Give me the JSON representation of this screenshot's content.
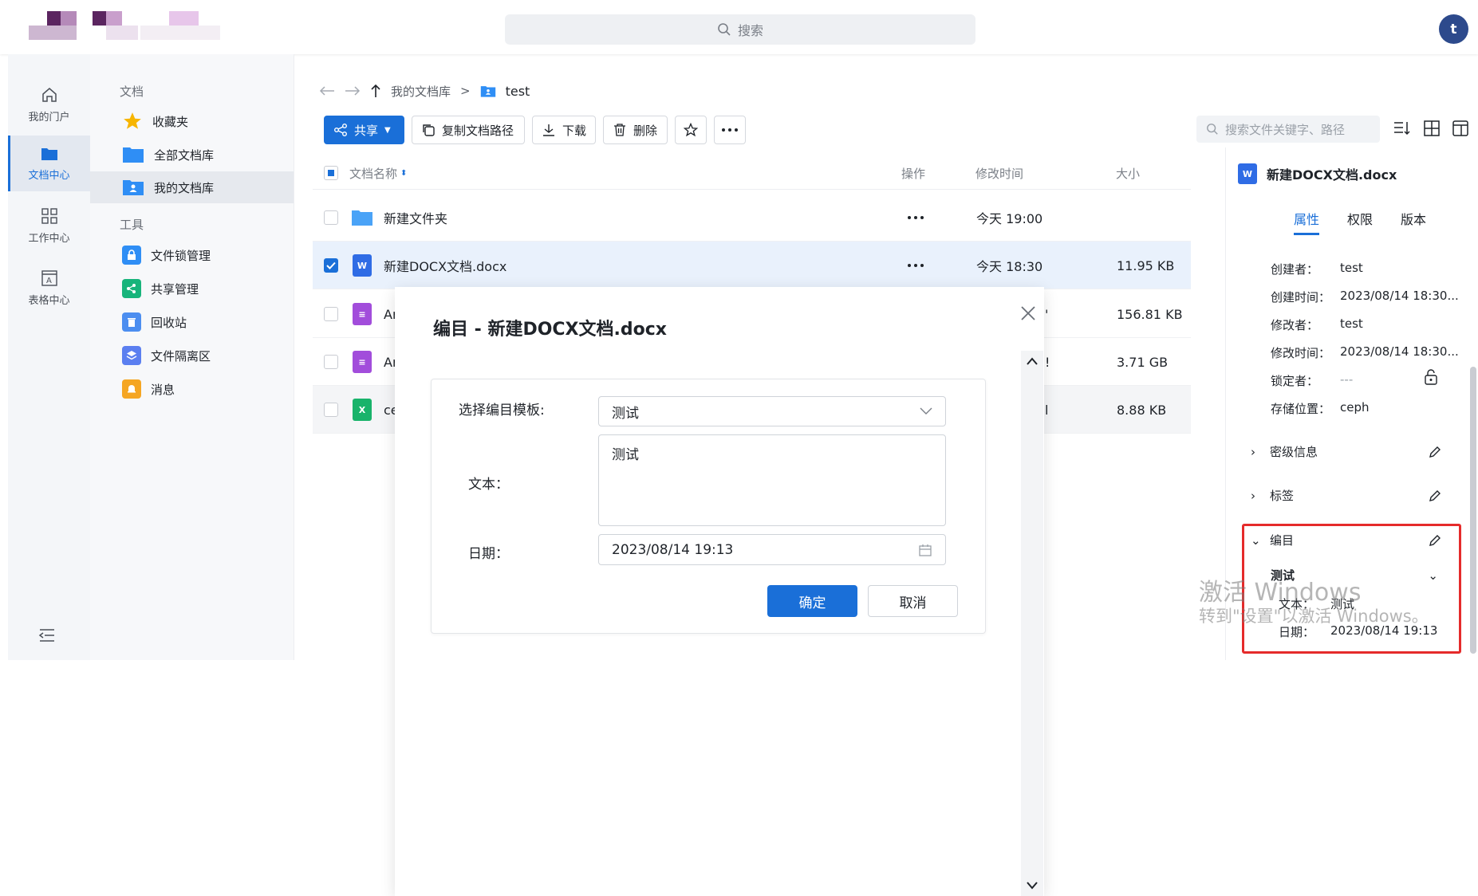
{
  "header": {
    "search_placeholder": "搜索",
    "avatar_letter": "t"
  },
  "rail": {
    "items": [
      {
        "label": "我的门户",
        "icon": "home-icon"
      },
      {
        "label": "文档中心",
        "icon": "folder-icon",
        "active": true
      },
      {
        "label": "工作中心",
        "icon": "grid-icon"
      },
      {
        "label": "表格中心",
        "icon": "table-icon"
      }
    ]
  },
  "sidenav": {
    "group_docs": "文档",
    "favorites": "收藏夹",
    "all_libraries": "全部文档库",
    "my_library": "我的文档库",
    "group_tools": "工具",
    "file_lock": "文件锁管理",
    "share_mgmt": "共享管理",
    "recycle": "回收站",
    "quarantine": "文件隔离区",
    "messages": "消息"
  },
  "breadcrumb": {
    "root": "我的文档库",
    "current": "test"
  },
  "toolbar": {
    "share": "共享",
    "copy_path": "复制文档路径",
    "download": "下载",
    "delete": "删除"
  },
  "file_search_placeholder": "搜索文件关键字、路径",
  "table": {
    "headers": {
      "name": "文档名称",
      "ops": "操作",
      "modified": "修改时间",
      "size": "大小"
    },
    "rows": [
      {
        "name": "新建文件夹",
        "modified": "今天 19:00",
        "size": "",
        "type": "folder"
      },
      {
        "name": "新建DOCX文档.docx",
        "modified": "今天 18:30",
        "size": "11.95 KB",
        "type": "docx",
        "selected": true
      },
      {
        "name": "Ar",
        "modified": "'",
        "size": "156.81 KB",
        "type": "archive"
      },
      {
        "name": "Ar",
        "modified": "!",
        "size": "3.71 GB",
        "type": "archive"
      },
      {
        "name": "ce",
        "modified": "l",
        "size": "8.88 KB",
        "type": "xlsx"
      }
    ]
  },
  "right_panel": {
    "title": "新建DOCX文档.docx",
    "tabs": [
      "属性",
      "权限",
      "版本"
    ],
    "active_tab": "属性",
    "props": [
      {
        "key": "创建者：",
        "value": "test"
      },
      {
        "key": "创建时间：",
        "value": "2023/08/14 18:30..."
      },
      {
        "key": "修改者：",
        "value": "test"
      },
      {
        "key": "修改时间：",
        "value": "2023/08/14 18:30..."
      },
      {
        "key": "锁定者：",
        "value": "---"
      },
      {
        "key": "存储位置：",
        "value": "ceph"
      }
    ],
    "sections": {
      "secret": "密级信息",
      "tags": "标签",
      "catalog": "编目"
    },
    "catalog": {
      "template": "测试",
      "text_label": "文本：",
      "text_value": "测试",
      "date_label": "日期：",
      "date_value": "2023/08/14 19:13"
    }
  },
  "watermark": {
    "line1": "激活 Windows",
    "line2": "转到\"设置\"以激活 Windows。"
  },
  "dialog": {
    "title": "编目 - 新建DOCX文档.docx",
    "template_label": "选择编目模板:",
    "template_value": "测试",
    "text_label": "文本：",
    "text_value": "测试",
    "date_label": "日期：",
    "date_value": "2023/08/14 19:13",
    "confirm": "确定",
    "cancel": "取消"
  }
}
